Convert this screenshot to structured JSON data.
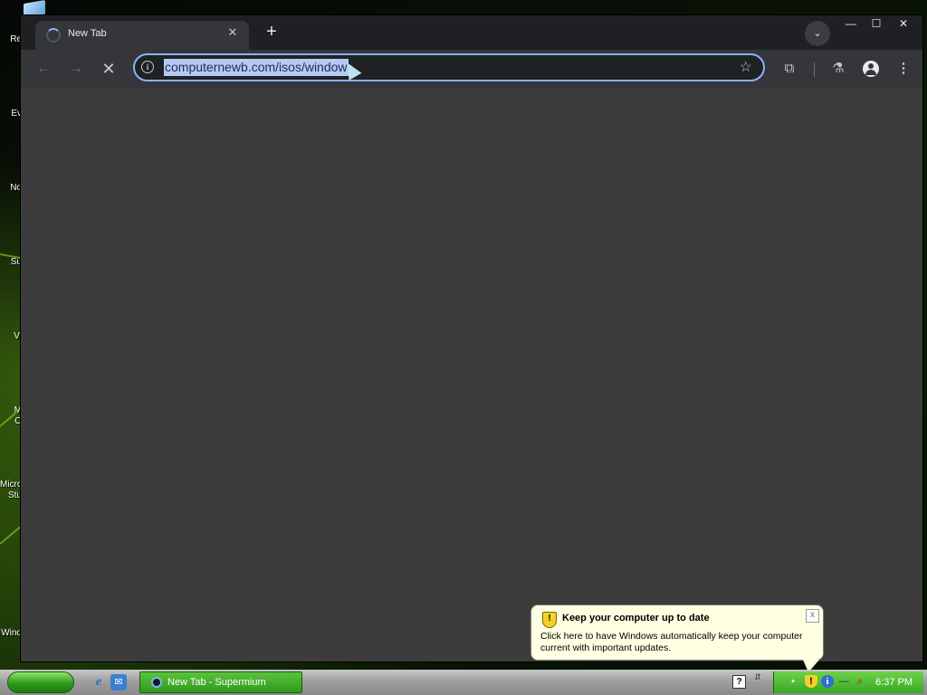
{
  "desktop": {
    "icons": [
      {
        "label": "Re"
      },
      {
        "label": "Ev"
      },
      {
        "label": "No"
      },
      {
        "label": "Su"
      },
      {
        "label": "Vi"
      },
      {
        "label": "M\nO"
      },
      {
        "label": "Micro\nStu"
      },
      {
        "label": "Wind"
      }
    ]
  },
  "browser": {
    "tab": {
      "title": "New Tab",
      "close_glyph": "✕",
      "loading": true
    },
    "new_tab_glyph": "+",
    "tab_search_glyph": "⌄",
    "window_controls": {
      "minimize": "—",
      "maximize": "☐",
      "close": "✕"
    },
    "toolbar": {
      "back_glyph": "←",
      "forward_glyph": "→",
      "stop_glyph": "✕",
      "omnibox": {
        "value": "computernewb.com/isos/window",
        "selected": true
      },
      "info_glyph": "i",
      "bookmark_glyph": "☆",
      "extensions_glyph": "⧉",
      "labs_glyph": "⚗",
      "menu_glyph": "⋮"
    }
  },
  "balloon": {
    "title": "Keep your computer up to date",
    "body": "Click here to have Windows automatically keep your computer current with important updates.",
    "close_glyph": "x"
  },
  "taskbar": {
    "task_button_label": "New Tab - Supermium",
    "help_glyph": "?",
    "arrows_glyph": "⇵",
    "clock": "6:37 PM",
    "icons": [
      "start-button",
      "internet-explorer-icon",
      "outlook-express-icon",
      "help-icon",
      "network-icon",
      "security-shield-icon",
      "info-icon",
      "search-icon"
    ]
  },
  "colors": {
    "chrome_dark": "#35363a",
    "content_bg": "#3c3c3c",
    "omnibox_border": "#8ab4f8",
    "taskbar_green": "#38a825",
    "balloon_bg": "#ffffe1"
  }
}
